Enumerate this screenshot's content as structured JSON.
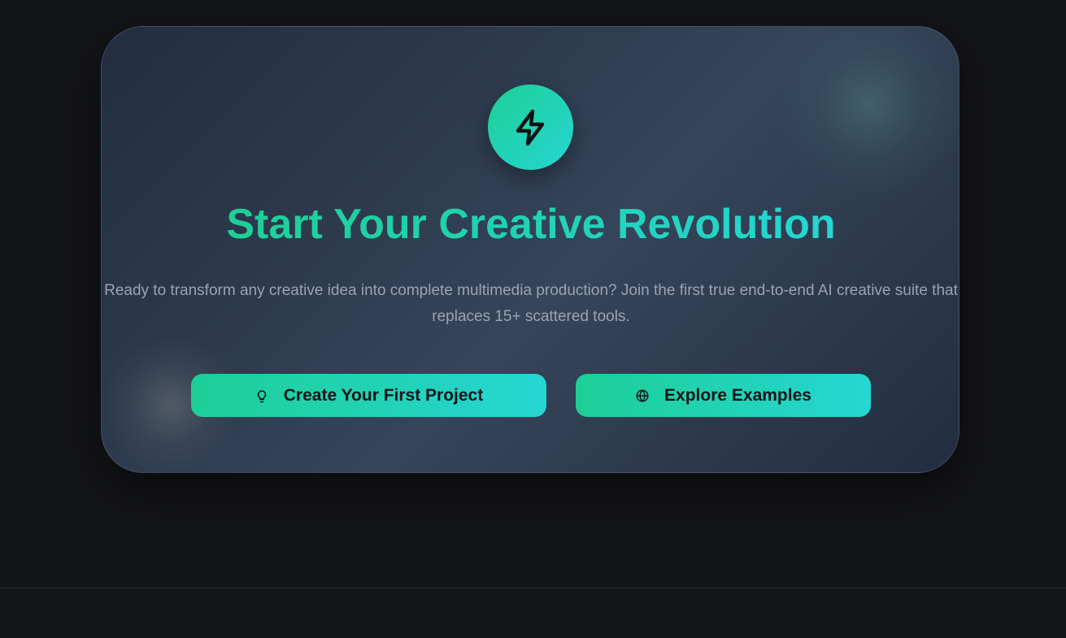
{
  "cta": {
    "icon": "lightning-bolt-icon",
    "headline": "Start Your Creative Revolution",
    "description": "Ready to transform any creative idea into complete multimedia production? Join the first true end-to-end AI creative suite that replaces 15+ scattered tools.",
    "buttons": [
      {
        "label": "Create Your First Project",
        "icon": "lightbulb-icon"
      },
      {
        "label": "Explore Examples",
        "icon": "globe-icon"
      }
    ]
  },
  "colors": {
    "background": "#131417",
    "accent_start": "#1dcf96",
    "accent_end": "#25d6d3",
    "text_muted": "#9aa3b2",
    "button_text": "#111418"
  }
}
